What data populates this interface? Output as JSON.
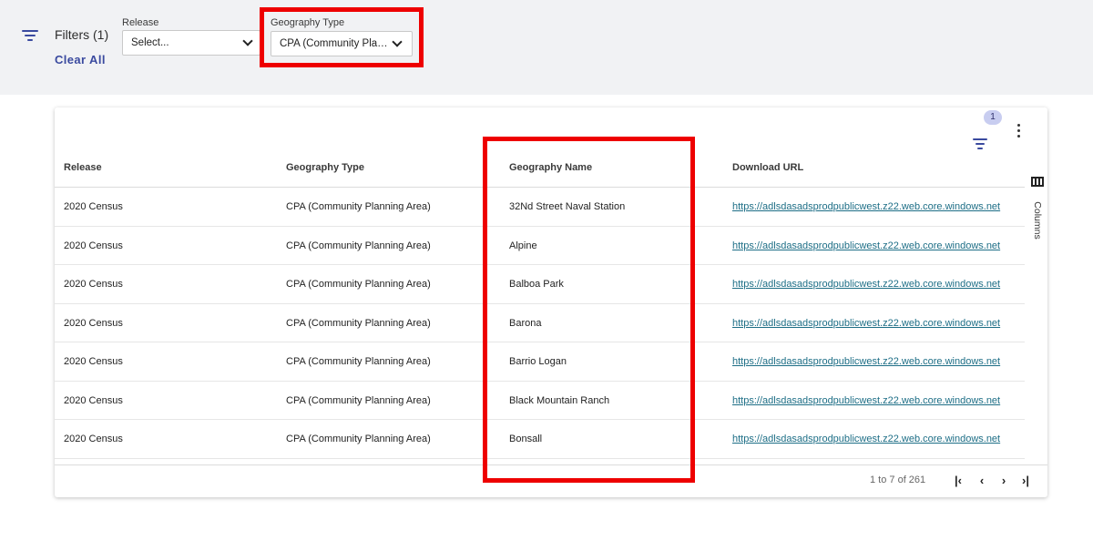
{
  "filters": {
    "label": "Filters (1)",
    "clear_all": "Clear All",
    "release": {
      "label": "Release",
      "value": "Select..."
    },
    "geography_type": {
      "label": "Geography Type",
      "value": "CPA (Community Planning Area)"
    }
  },
  "toolbar": {
    "filter_badge": "1"
  },
  "grid": {
    "columns": [
      "Release",
      "Geography Type",
      "Geography Name",
      "Download URL"
    ],
    "rows": [
      [
        "2020 Census",
        "CPA (Community Planning Area)",
        "32Nd Street Naval Station",
        "https://adlsdasadsprodpublicwest.z22.web.core.windows.net"
      ],
      [
        "2020 Census",
        "CPA (Community Planning Area)",
        "Alpine",
        "https://adlsdasadsprodpublicwest.z22.web.core.windows.net"
      ],
      [
        "2020 Census",
        "CPA (Community Planning Area)",
        "Balboa Park",
        "https://adlsdasadsprodpublicwest.z22.web.core.windows.net"
      ],
      [
        "2020 Census",
        "CPA (Community Planning Area)",
        "Barona",
        "https://adlsdasadsprodpublicwest.z22.web.core.windows.net"
      ],
      [
        "2020 Census",
        "CPA (Community Planning Area)",
        "Barrio Logan",
        "https://adlsdasadsprodpublicwest.z22.web.core.windows.net"
      ],
      [
        "2020 Census",
        "CPA (Community Planning Area)",
        "Black Mountain Ranch",
        "https://adlsdasadsprodpublicwest.z22.web.core.windows.net"
      ],
      [
        "2020 Census",
        "CPA (Community Planning Area)",
        "Bonsall",
        "https://adlsdasadsprodpublicwest.z22.web.core.windows.net"
      ]
    ]
  },
  "side_panel": {
    "columns_label": "Columns"
  },
  "pager": {
    "summary": "1 to 7 of 261"
  },
  "colors": {
    "accent": "#3a4a9f",
    "highlight": "#ee0000",
    "link": "#1d6e86"
  }
}
